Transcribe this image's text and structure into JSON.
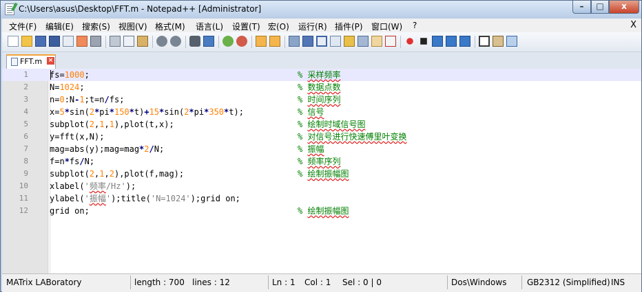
{
  "window": {
    "title": "C:\\Users\\asus\\Desktop\\FFT.m - Notepad++ [Administrator]",
    "controls": {
      "minimize": "–",
      "maximize": "□",
      "close": "x"
    }
  },
  "menu": {
    "items": [
      "文件(F)",
      "编辑(E)",
      "搜索(S)",
      "视图(V)",
      "格式(M)",
      "语言(L)",
      "设置(T)",
      "宏(O)",
      "运行(R)",
      "插件(P)",
      "窗口(W)",
      "?"
    ],
    "close": "X"
  },
  "tab": {
    "label": "FFT.m"
  },
  "code_lines": [
    {
      "n": "1",
      "code": "fs=1000;",
      "comment": "采样频率"
    },
    {
      "n": "2",
      "code": "N=1024;",
      "comment": "数据点数"
    },
    {
      "n": "3",
      "code": "n=0:N-1;t=n/fs;",
      "comment": "时间序列"
    },
    {
      "n": "4",
      "code": "x=5*sin(2*pi*150*t)+15*sin(2*pi*350*t);",
      "comment": "信号"
    },
    {
      "n": "5",
      "code": "subplot(2,1,1),plot(t,x);",
      "comment": "绘制时域信号图"
    },
    {
      "n": "6",
      "code": "y=fft(x,N);",
      "comment": "对信号进行快速傅里叶变换"
    },
    {
      "n": "7",
      "code": "mag=abs(y);mag=mag*2/N;",
      "comment": "振幅"
    },
    {
      "n": "8",
      "code": "f=n*fs/N;",
      "comment": "频率序列"
    },
    {
      "n": "9",
      "code": "subplot(2,1,2),plot(f,mag);",
      "comment": "绘制振幅图"
    },
    {
      "n": "10",
      "code": "xlabel('频率/Hz');",
      "comment": ""
    },
    {
      "n": "11",
      "code": "ylabel('振幅');title('N=1024');grid on;",
      "comment": ""
    },
    {
      "n": "12",
      "code": "grid on;",
      "comment": "绘制振幅图"
    }
  ],
  "comment_marker": "%",
  "status": {
    "language": "MATrix LABoratory",
    "length": "length : 700",
    "lines": "lines : 12",
    "ln": "Ln : 1",
    "col": "Col : 1",
    "sel": "Sel : 0 | 0",
    "eol": "Dos\\Windows",
    "encoding": "GB2312 (Simplified)",
    "mode": "INS"
  }
}
